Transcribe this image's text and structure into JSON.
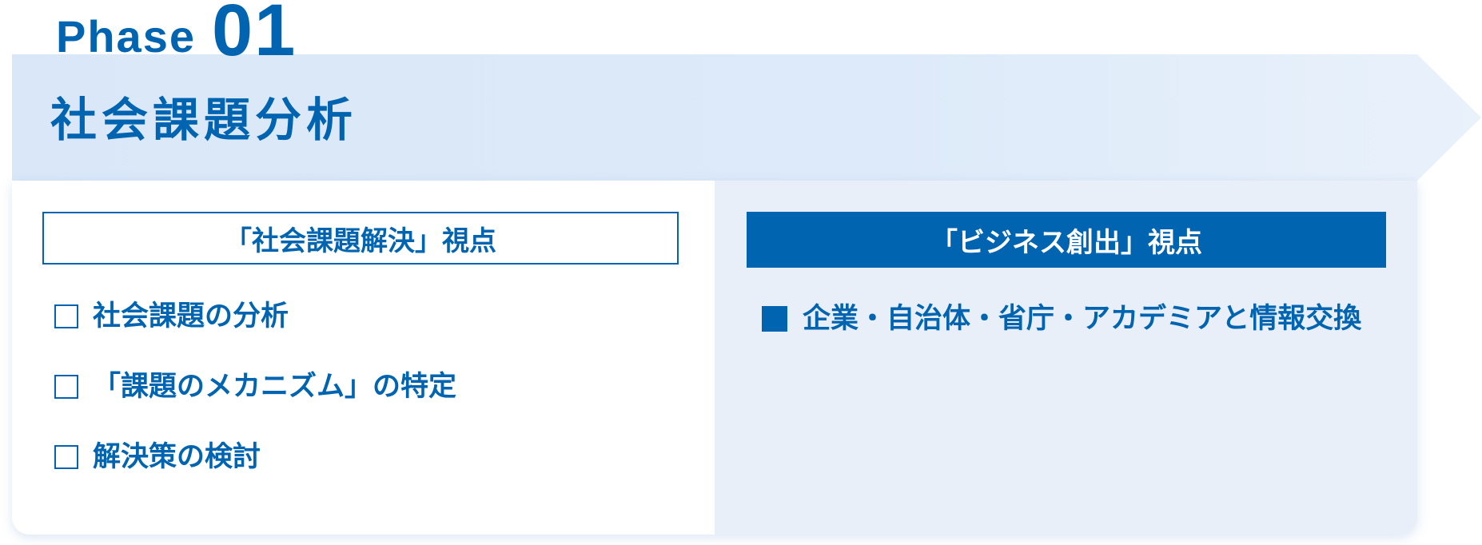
{
  "phase": {
    "word": "Phase",
    "number": "01"
  },
  "band": {
    "title": "社会課題分析"
  },
  "left_panel": {
    "heading": "「社会課題解決」視点",
    "items": [
      {
        "icon": "empty-square",
        "label": "社会課題の分析"
      },
      {
        "icon": "empty-square",
        "label": "「課題のメカニズム」の特定"
      },
      {
        "icon": "empty-square",
        "label": "解決策の検討"
      }
    ]
  },
  "right_panel": {
    "heading": "「ビジネス創出」視点",
    "items": [
      {
        "icon": "filled-square",
        "label": "企業・自治体・省庁・アカデミアと情報交換"
      }
    ]
  },
  "colors": {
    "primary": "#0064B1",
    "band": "#DAE8F8",
    "right_panel_bg": "#E8EFF8",
    "left_panel_bg": "#FFFFFF"
  }
}
